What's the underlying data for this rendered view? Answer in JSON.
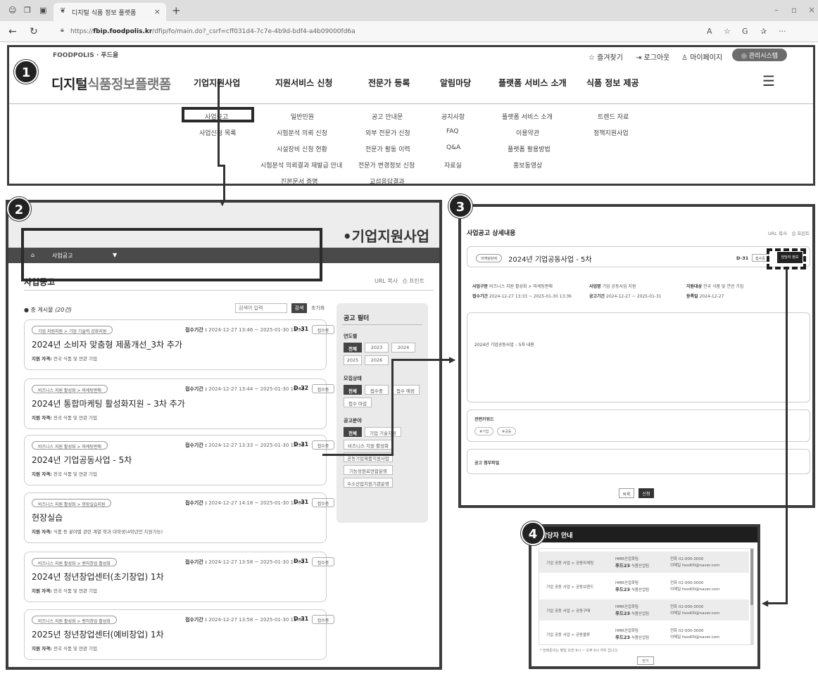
{
  "browser": {
    "tab_title": "디지털 식품 정보 플랫폼",
    "url_prefix": "https://",
    "url_domain": "fbip.foodpolis.kr",
    "url_path": "/dfip/fo/main.do?_csrf=cff031d4-7c7e-4b9d-bdf4-a4b09000fd6a",
    "icons": [
      "profile-icon",
      "collections-icon",
      "tab-actions-icon",
      "close-icon",
      "new-tab-icon",
      "back-icon",
      "refresh-icon",
      "lock-icon",
      "read-aloud-icon",
      "favorite-icon",
      "copilot-icon",
      "favorites-bar-icon",
      "more-icon"
    ]
  },
  "header": {
    "logo_small": "FOODPOLIS · 푸드올",
    "brand_strong": "디지털",
    "brand_light": "식품정보플랫폼",
    "util": {
      "favorites": "☆ 즐겨찾기",
      "logout": "⇥ 로그아웃",
      "mypage": "♙ 마이페이지",
      "admin": "◎ 관리시스템"
    },
    "gnb": [
      "기업지원사업",
      "지원서비스 신청",
      "전문가 등록",
      "알림마당",
      "플랫폼 서비스 소개",
      "식품 정보 제공"
    ],
    "submenu": {
      "col1": [
        "사업공고",
        "사업신청 목록"
      ],
      "col2": [
        "일반민원",
        "시험분석 의뢰 신청",
        "시설장비 신청 현황",
        "시험분석 의뢰결과 재발급 안내",
        "진본문서 증명"
      ],
      "col3": [
        "공고 안내문",
        "외부 전문가 신청",
        "전문가 활동 이력",
        "전문가 변경정보 신청",
        "교섭응답결과"
      ],
      "col4": [
        "공지사항",
        "FAQ",
        "Q&A",
        "자료실"
      ],
      "col5": [
        "플랫폼 서비스 소개",
        "이용약관",
        "플랫폼 활용방법",
        "홍보동영상"
      ],
      "col6": [
        "트렌드 자료",
        "정책지원사업"
      ]
    }
  },
  "badges": [
    "1",
    "2",
    "3",
    "4"
  ],
  "list_page": {
    "banner_title": "•기업지원사업",
    "breadcrumb": "사업공고",
    "title": "사업공고",
    "url_copy": "URL 복사",
    "print": "⎙ 프린트",
    "total_label": "● 총 게시물",
    "total_count": "(20건)",
    "search_placeholder": "검색어 입력",
    "search_button": "검색",
    "reset": "초기화",
    "period_label": "접수기간 :",
    "qual_label": "지원 자격:",
    "cards": [
      {
        "category": "기업 지원지원 > 기업 기술력 강화지원",
        "title": "2024년 소비자 맞춤형 제품개선_3차 추가",
        "qual": "전국 식품 및 연관 기업",
        "period": "2024-12-27 13:46 ~ 2025-01-30 13:52",
        "dday": "D-31",
        "status": "접수중"
      },
      {
        "category": "비즈니스 지원 활성화 > 마케팅판매",
        "title": "2024년 통합마케팅 활성화지원 – 3차 추가",
        "qual": "전국 식품 및 연관 기업",
        "period": "2024-12-27 13:44 ~ 2025-01-30 16:48",
        "dday": "D-32",
        "status": "접수중"
      },
      {
        "category": "비즈니스 지원 활성화 > 마케팅판매",
        "title": "2024년 기업공동사업 - 5차",
        "qual": "전국 식품 및 연관 기업",
        "period": "2024-12-27 13:33 ~ 2025-01-30 13:36",
        "dday": "D-31",
        "status": "접수중"
      },
      {
        "category": "비즈니스 지원 활성화 > 현장실습지원",
        "title": "현장실습",
        "qual": "식품 등 분야별 관련 계열 학과 대학생(4학년만 지원가능)",
        "period": "2024-12-27 14:18 ~ 2025-01-30 12:00",
        "dday": "D-31",
        "status": "접수중"
      },
      {
        "category": "비즈니스 지원 활성화 > 벤처창업 활성화",
        "title": "2024년 청년창업센터(초기창업) 1차",
        "qual": "전국 식품 및 연관 기업",
        "period": "2024-12-27 13:58 ~ 2025-01-30 14:03",
        "dday": "D-31",
        "status": "접수중"
      },
      {
        "category": "비즈니스 지원 활성화 > 벤처창업 활성화",
        "title": "2025년 청년창업센터(예비창업) 1차",
        "qual": "전국 식품 및 연관 기업",
        "period": "2024-12-27 13:58 ~ 2025-01-30 13:04",
        "dday": "D-31",
        "status": "접수중"
      }
    ],
    "filter": {
      "title": "공고 필터",
      "year_label": "연도별",
      "years": [
        "전체",
        "2023",
        "2024",
        "2025",
        "2026"
      ],
      "state_label": "모집상태",
      "states": [
        "전체",
        "접수중",
        "접수 예정",
        "접수 마감"
      ],
      "field_label": "공고분야",
      "fields": [
        "전체",
        "기업 기술지원",
        "비즈니스 지원 활성화",
        "공동기업제품지원사업",
        "기능성원료연합운영",
        "수소산업지원기관운영"
      ]
    }
  },
  "detail_page": {
    "title": "사업공고 상세내용",
    "url_copy": "URL 복사",
    "print": "⎙ 프린트",
    "pill": "마케팅판매",
    "name": "2024년 기업공동사업 - 5차",
    "dday": "D-31",
    "status": "접수중",
    "manager_btn": "담당자 정보",
    "meta": {
      "l1_label": "사업구분",
      "l1": "비즈니스 지원 활성화 > 마케팅판매",
      "l2_label": "접수기간",
      "l2": "2024-12-27 13:33 ~ 2025-01-30 13:36",
      "m1_label": "사업명",
      "m1": "기업 공동사업 지원",
      "m2_label": "공고기간",
      "m2": "2024-12-27 ~ 2025-01-31",
      "r1_label": "지원대상",
      "r1": "전국 식품 및 연관 기업",
      "r2_label": "등록일",
      "r2": "2024-12-27"
    },
    "body_text": "2024년 기업공동사업 – 5차 내용",
    "keyword_label": "관련키워드",
    "keywords": [
      "#기업",
      "#공동"
    ],
    "attach_label": "공고 첨부파일",
    "btn_list": "목록",
    "btn_apply": "신청"
  },
  "contact_modal": {
    "title": "담당자 안내",
    "rows": [
      {
        "biz": "기업 공동 사업 > 공동마케팅",
        "org": "HMR산업화팀",
        "org_sub": "푸드23",
        "org_sub2": "식품산업팀",
        "tel": "전화  02-000-0000",
        "mail": "이메일  food00@naver.com"
      },
      {
        "biz": "기업 공동 사업 > 공동브랜드",
        "org": "HMR산업화팀",
        "org_sub": "푸드23",
        "org_sub2": "식품산업팀",
        "tel": "전화  02-000-0000",
        "mail": "이메일  food00@naver.com"
      },
      {
        "biz": "기업 공동 사업 > 공동구매",
        "org": "HMR산업화팀",
        "org_sub": "푸드23",
        "org_sub2": "식품산업팀",
        "tel": "전화  02-000-0000",
        "mail": "이메일  food00@naver.com"
      },
      {
        "biz": "기업 공동 사업 > 공동물류",
        "org": "HMR산업화팀",
        "org_sub": "푸드23",
        "org_sub2": "식품산업팀",
        "tel": "전화  02-000-0000",
        "mail": "이메일  food00@naver.com"
      }
    ],
    "note": "* 전화문의는 평일 오전 9시 ~ 오후 6시 까지 입니다.",
    "ok": "닫기"
  }
}
